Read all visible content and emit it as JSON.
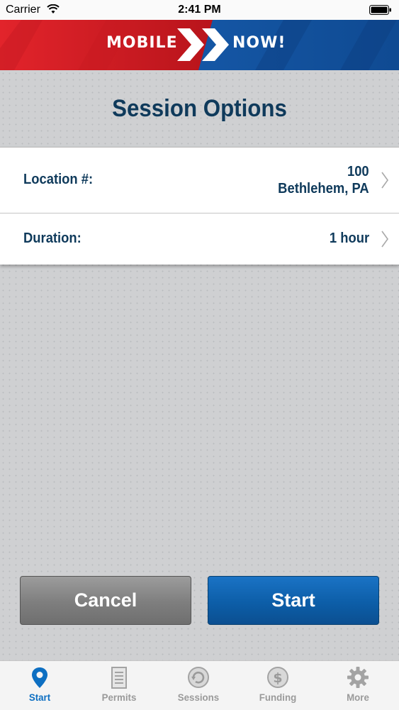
{
  "status_bar": {
    "carrier": "Carrier",
    "time": "2:41 PM"
  },
  "banner": {
    "left_text": "MOBILE",
    "right_text": "NOW!"
  },
  "page": {
    "title": "Session Options"
  },
  "options": {
    "location": {
      "label": "Location #:",
      "value_line1": "100",
      "value_line2": "Bethlehem, PA"
    },
    "duration": {
      "label": "Duration:",
      "value": "1 hour"
    }
  },
  "buttons": {
    "cancel": "Cancel",
    "start": "Start"
  },
  "tabs": [
    {
      "label": "Start",
      "icon": "map-pin-icon",
      "active": true
    },
    {
      "label": "Permits",
      "icon": "document-icon",
      "active": false
    },
    {
      "label": "Sessions",
      "icon": "refresh-icon",
      "active": false
    },
    {
      "label": "Funding",
      "icon": "dollar-icon",
      "active": false
    },
    {
      "label": "More",
      "icon": "gear-icon",
      "active": false
    }
  ],
  "colors": {
    "accent": "#0d6fc2",
    "title": "#0f3a5b",
    "banner_red": "#d81f26",
    "banner_blue": "#1657a8"
  }
}
